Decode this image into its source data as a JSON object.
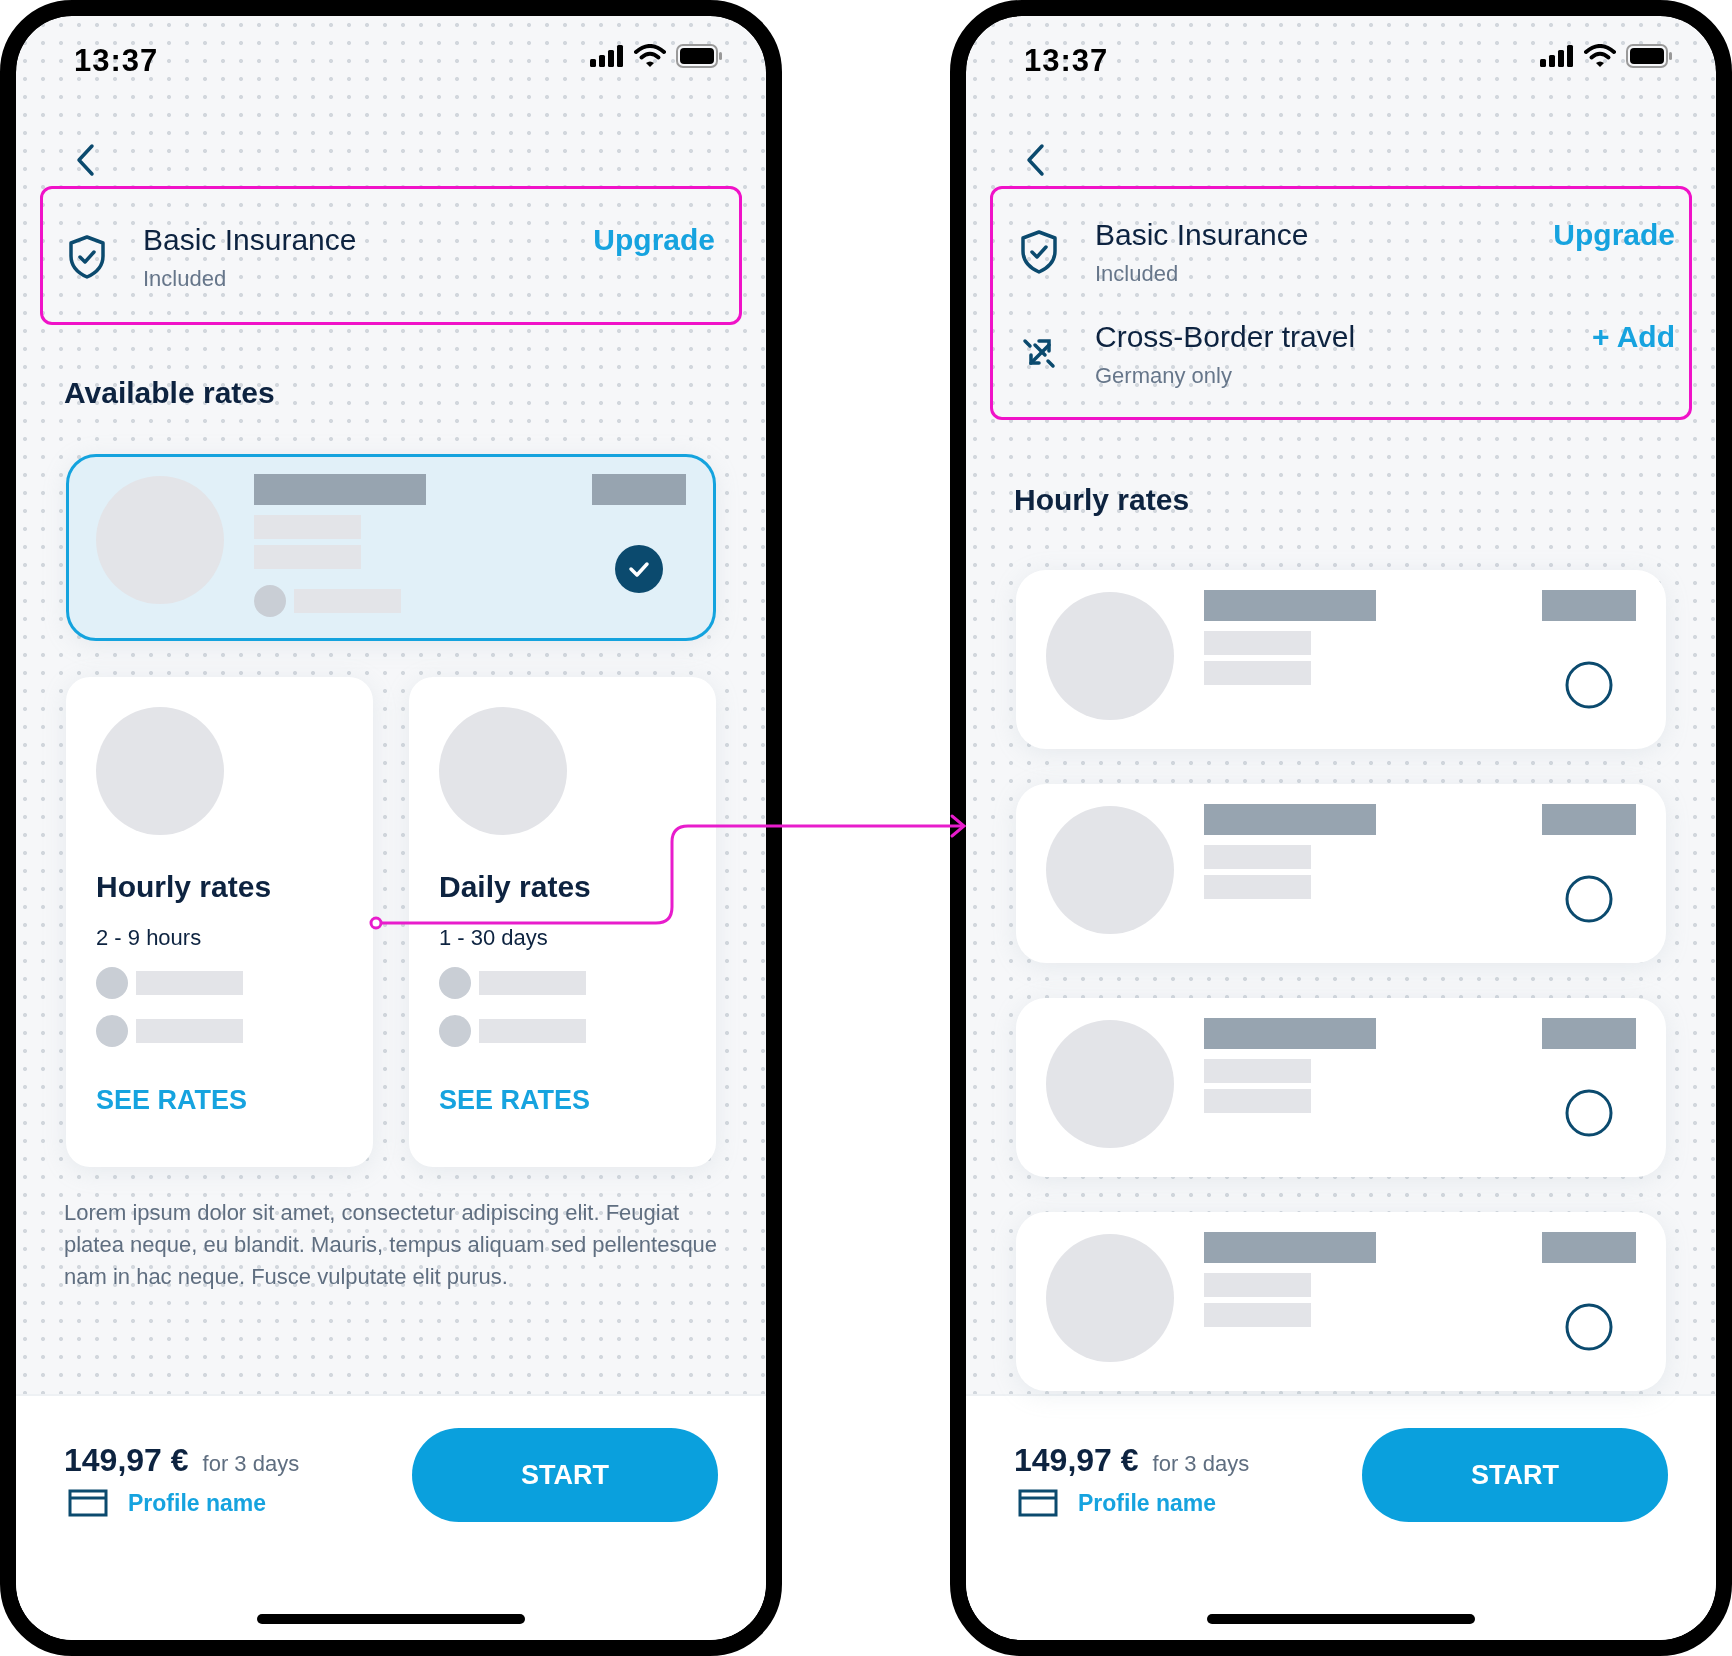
{
  "screens": [
    {
      "kind": "overview",
      "time": "13:37",
      "coverage": [
        {
          "kind": "shield",
          "title": "Basic Insurance",
          "subtitle": "Included",
          "action": "Upgrade"
        }
      ],
      "heading": "Available rates",
      "options": [
        {
          "selected": true
        }
      ],
      "rate_cards": [
        {
          "title": "Hourly rates",
          "subtitle": "2 - 9 hours",
          "link": "SEE RATES"
        },
        {
          "title": "Daily rates",
          "subtitle": "1 - 30 days",
          "link": "SEE RATES"
        }
      ],
      "description": "Lorem ipsum dolor sit amet, consectetur adipiscing elit. Feugiat platea neque, eu blandit. Mauris, tempus aliquam sed pellentesque nam in hac neque. Fusce vulputate elit purus.",
      "footer": {
        "price": "149,97 €",
        "price_note": "for 3 days",
        "profile": "Profile name",
        "button": "START"
      }
    },
    {
      "kind": "list",
      "time": "13:37",
      "coverage": [
        {
          "kind": "shield",
          "title": "Basic Insurance",
          "subtitle": "Included",
          "action": "Upgrade"
        },
        {
          "kind": "border",
          "title": "Cross-Border travel",
          "subtitle": "Germany only",
          "action": "+ Add"
        }
      ],
      "heading": "Hourly rates",
      "options": [
        {
          "selected": false
        },
        {
          "selected": false
        },
        {
          "selected": false
        },
        {
          "selected": false
        }
      ],
      "footer": {
        "price": "149,97 €",
        "price_note": "for 3 days",
        "profile": "Profile name",
        "button": "START"
      }
    }
  ]
}
